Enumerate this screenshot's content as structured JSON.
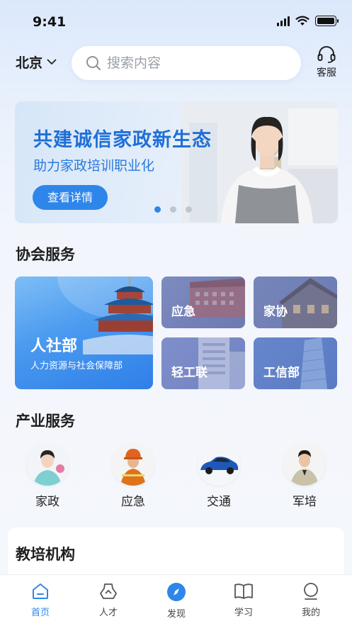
{
  "status": {
    "time": "9:41"
  },
  "header": {
    "city": "北京",
    "search_placeholder": "搜索内容",
    "service_label": "客服"
  },
  "banner": {
    "title": "共建诚信家政新生态",
    "subtitle": "助力家政培训职业化",
    "button_label": "查看详情",
    "slide_count": 3,
    "active_slide": 1
  },
  "association": {
    "title": "协会服务",
    "main_card": {
      "title": "人社部",
      "subtitle": "人力资源与社会保障部"
    },
    "cards": [
      {
        "label": "应急"
      },
      {
        "label": "家协"
      },
      {
        "label": "轻工联"
      },
      {
        "label": "工信部"
      }
    ]
  },
  "industry": {
    "title": "产业服务",
    "items": [
      {
        "label": "家政"
      },
      {
        "label": "应急"
      },
      {
        "label": "交通"
      },
      {
        "label": "军培"
      }
    ]
  },
  "education": {
    "title": "教培机构"
  },
  "tabbar": {
    "active": "首页",
    "tabs": [
      {
        "label": "首页",
        "icon": "home-icon"
      },
      {
        "label": "人才",
        "icon": "talent-icon"
      },
      {
        "label": "发现",
        "icon": "compass-icon"
      },
      {
        "label": "学习",
        "icon": "book-icon"
      },
      {
        "label": "我的",
        "icon": "user-icon"
      }
    ]
  },
  "colors": {
    "accent": "#2f86ea",
    "title_blue": "#1f6fd8",
    "dot_inactive": "#bfc6cf"
  }
}
